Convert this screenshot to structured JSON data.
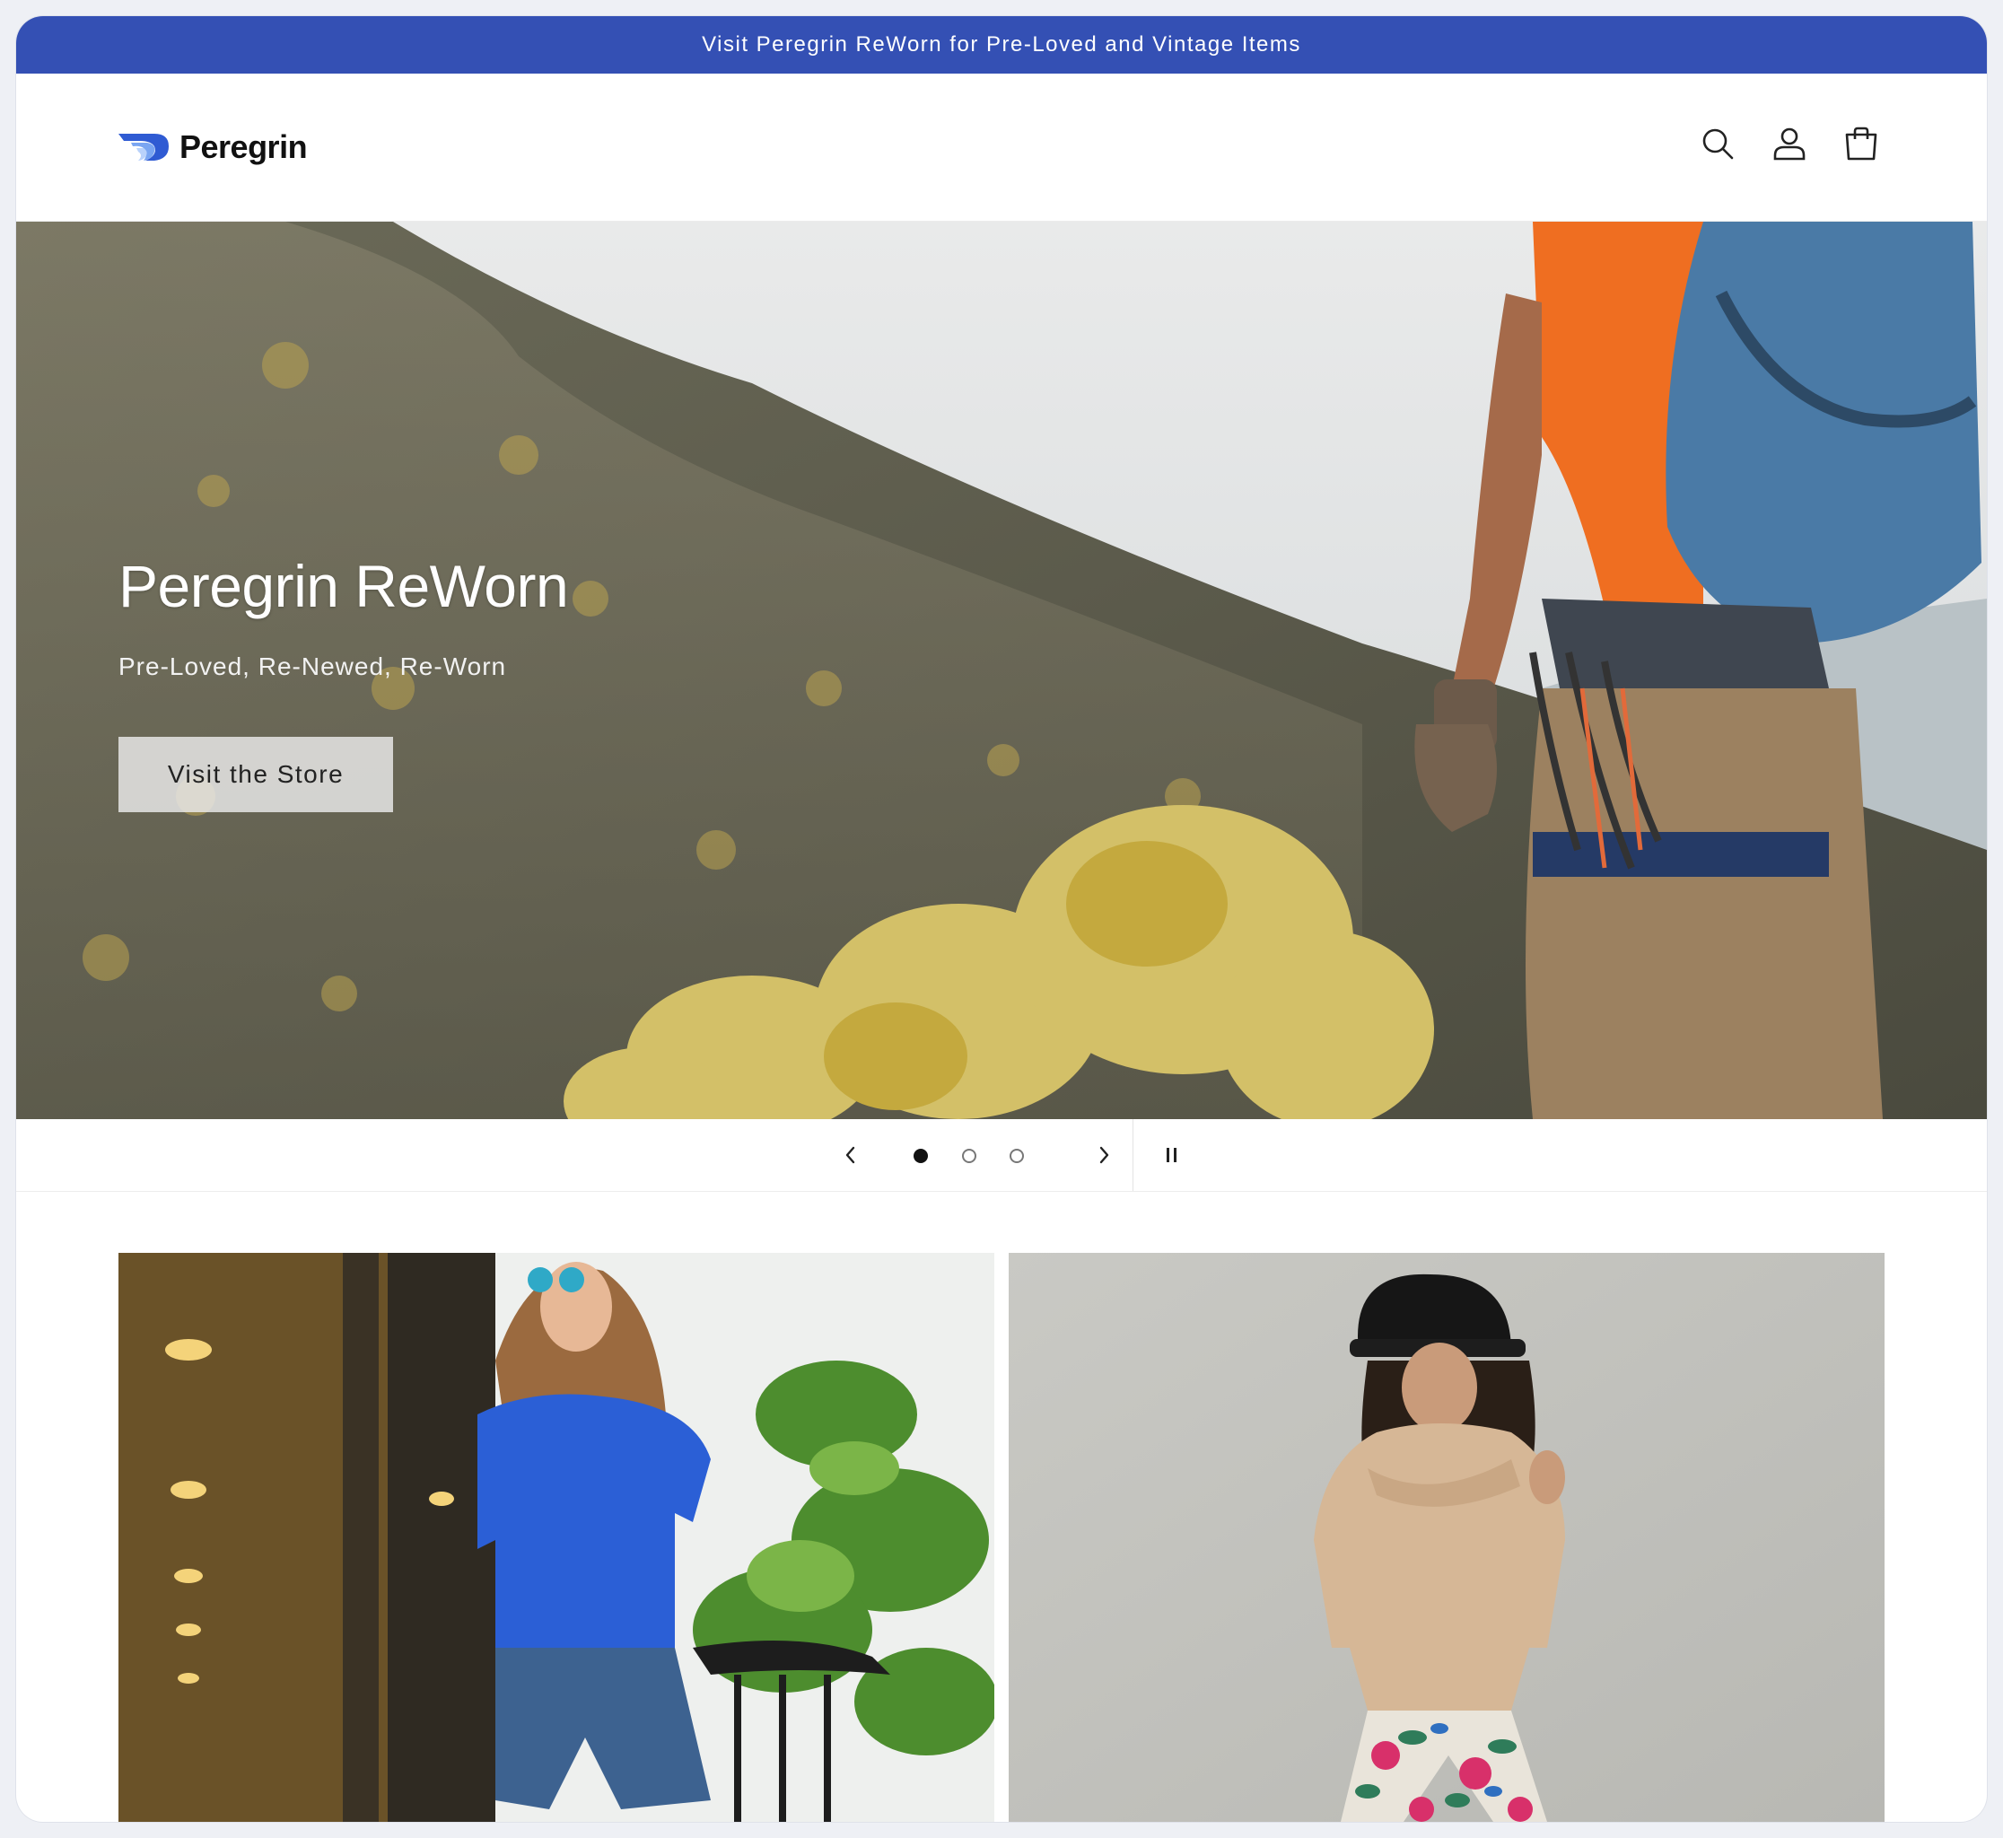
{
  "announcement": {
    "text": "Visit Peregrin ReWorn for Pre-Loved and Vintage Items"
  },
  "header": {
    "brand": "Peregrin",
    "logo_icon": "peregrin-wing-logo",
    "icons": [
      "search-icon",
      "account-icon",
      "cart-icon"
    ]
  },
  "hero": {
    "title": "Peregrin ReWorn",
    "subtitle": "Pre-Loved, Re-Newed, Re-Worn",
    "cta_label": "Visit the Store"
  },
  "slider": {
    "slide_count": 3,
    "active_slide": 1,
    "prev_icon": "chevron-left-icon",
    "next_icon": "chevron-right-icon",
    "pause_icon": "pause-icon"
  },
  "colors": {
    "announcement_bg": "#3450b4",
    "brand_blue": "#2f5bd3",
    "text_dark": "#111111"
  }
}
